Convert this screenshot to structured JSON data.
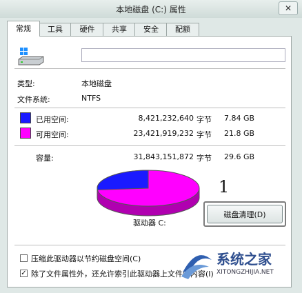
{
  "window": {
    "title": "本地磁盘 (C:) 属性",
    "close_glyph": "✕"
  },
  "tabs": [
    {
      "label": "常规"
    },
    {
      "label": "工具"
    },
    {
      "label": "硬件"
    },
    {
      "label": "共享"
    },
    {
      "label": "安全"
    },
    {
      "label": "配额"
    }
  ],
  "general": {
    "name_value": "",
    "type_label": "类型:",
    "type_value": "本地磁盘",
    "fs_label": "文件系统:",
    "fs_value": "NTFS",
    "used": {
      "label": "已用空间:",
      "bytes": "8,421,232,640",
      "unit": "字节",
      "size": "7.84 GB",
      "color": "#1a1aff"
    },
    "free": {
      "label": "可用空间:",
      "bytes": "23,421,919,232",
      "unit": "字节",
      "size": "21.8 GB",
      "color": "#ff00ff"
    },
    "capacity": {
      "label": "容量:",
      "bytes": "31,843,151,872",
      "unit": "字节",
      "size": "29.6 GB"
    },
    "drive_label": "驱动器 C:",
    "used_fraction": 0.2645,
    "annotation": "1",
    "cleanup_button": "磁盘清理(D)",
    "compress": {
      "label": "压缩此驱动器以节约磁盘空间(C)",
      "checked": false
    },
    "index": {
      "label": "除了文件属性外，还允许索引此驱动器上文件的内容(I)",
      "checked": true,
      "check_glyph": "✓"
    }
  },
  "watermark": {
    "text": "系统之家",
    "url": "XITONGZHIJIA.NET"
  }
}
